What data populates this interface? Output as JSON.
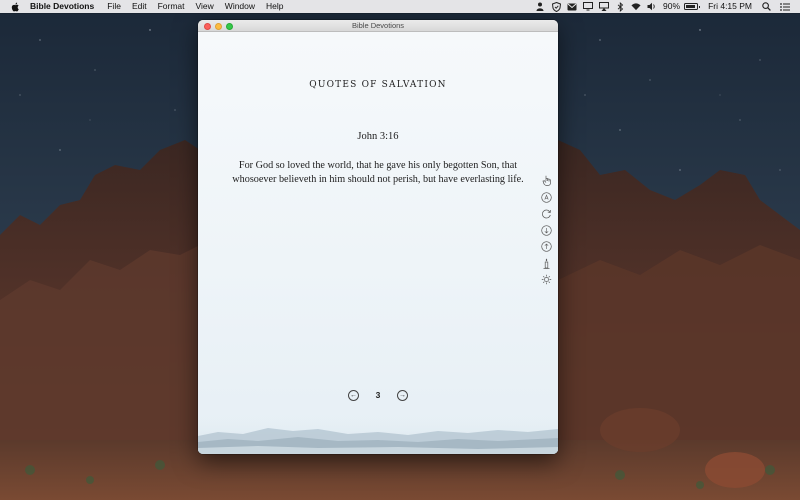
{
  "menubar": {
    "app_name": "Bible Devotions",
    "items": [
      "File",
      "Edit",
      "Format",
      "View",
      "Window",
      "Help"
    ],
    "tray_icons": [
      "user-icon",
      "shield-icon",
      "mail-icon",
      "screen-icon",
      "airplay-icon",
      "bluetooth-icon",
      "wifi-icon",
      "volume-icon"
    ],
    "battery_percent": "90%",
    "battery_level": 0.9,
    "clock": "Fri 4:15 PM",
    "extra_icons": [
      "search-icon",
      "list-icon"
    ]
  },
  "window": {
    "title": "Bible Devotions",
    "section_title": "Quotes of Salvation",
    "verse_reference": "John 3:16",
    "verse_text": "For God so loved the world, that he gave his only begotten Son, that whosoever believeth in him should not perish, but have everlasting life.",
    "page_number": "3",
    "prev_label": "←",
    "next_label": "→",
    "side_tools": [
      "hand-pointer-icon",
      "circle-a-icon",
      "refresh-icon",
      "circle-down-icon",
      "circle-up-icon",
      "candle-icon",
      "settings-icon"
    ]
  },
  "colors": {
    "sky_top": "#1b2838",
    "sky_bottom": "#36485a",
    "rocks": "#4a2f28",
    "window_bg": "#f1f6fa",
    "text": "#1e1e1e"
  }
}
